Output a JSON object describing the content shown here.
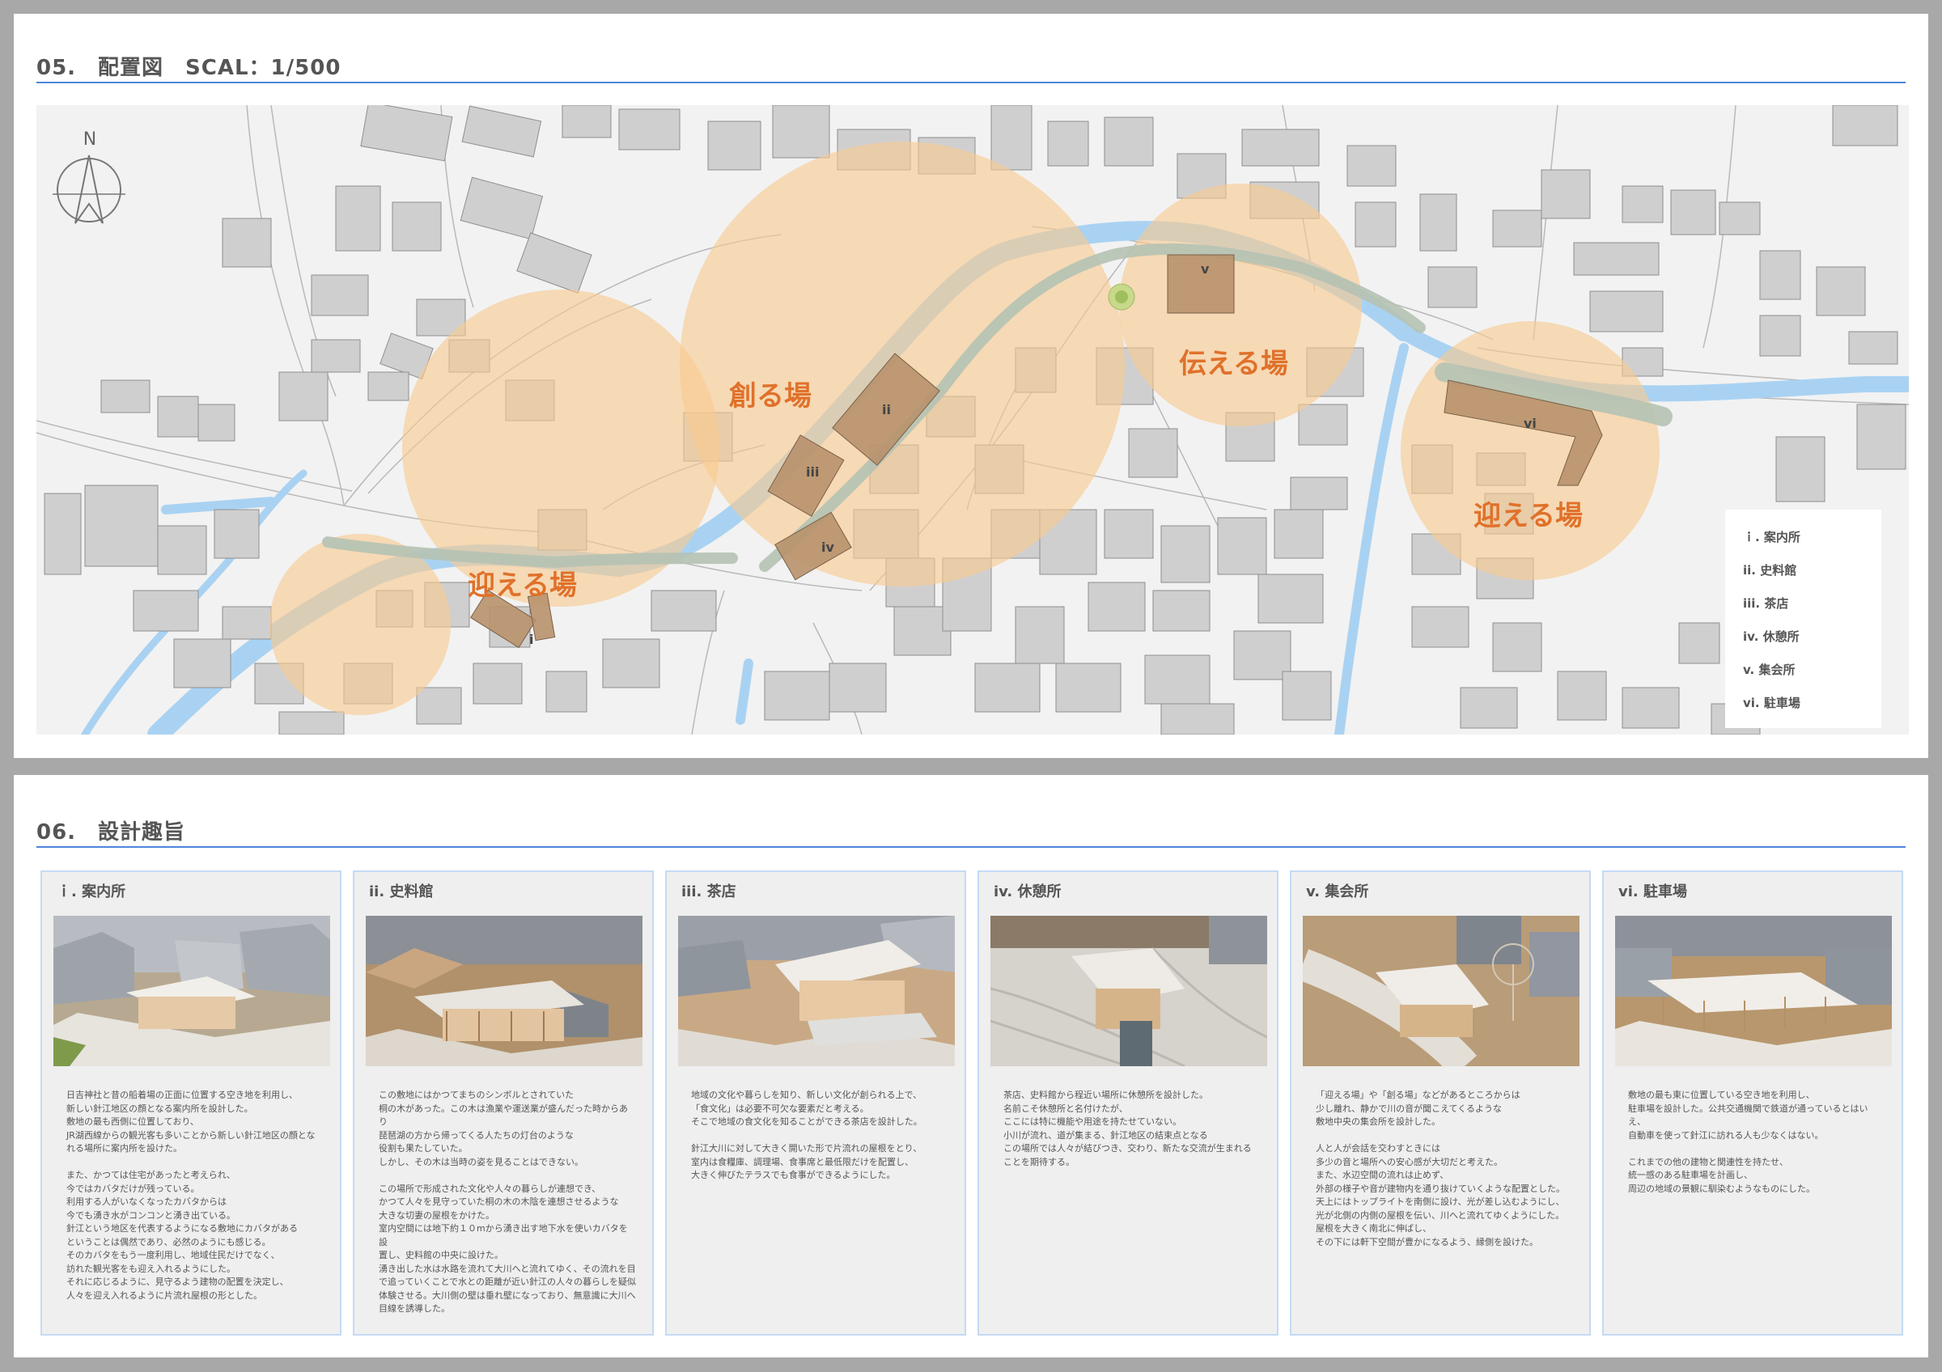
{
  "site_plan": {
    "title": "05.　配置図　SCAL：1/500",
    "north_label": "N",
    "zones": [
      "創る場",
      "伝える場",
      "迎える場",
      "迎える場"
    ],
    "buildings": [
      "i",
      "ii",
      "iii",
      "iv",
      "v",
      "vi"
    ],
    "legend": [
      "ｉ. 案内所",
      "ii. 史料館",
      "iii. 茶店",
      "iv. 休憩所",
      "v. 集会所",
      "vi. 駐車場"
    ]
  },
  "design": {
    "title": "06.　設計趣旨",
    "cards": [
      {
        "title": "ｉ. 案内所",
        "text": "日吉神社と昔の船着場の正面に位置する空き地を利用し、\n新しい針江地区の顔となる案内所を設計した。\n敷地の最も西側に位置しており、\nJR湖西線からの観光客も多いことから新しい針江地区の顔とな\nれる場所に案内所を設けた。\n\nまた、かつては住宅があったと考えられ、\n今ではカバタだけが残っている。\n利用する人がいなくなったカバタからは\n今でも湧き水がコンコンと湧き出ている。\n針江という地区を代表するようになる敷地にカバタがある\nということは偶然であり、必然のようにも感じる。\nそのカバタをもう一度利用し、地域住民だけでなく、\n訪れた観光客をも迎え入れるようにした。\nそれに応じるように、見守るよう建物の配置を決定し、\n人々を迎え入れるように片流れ屋根の形とした。"
      },
      {
        "title": "ii. 史料館",
        "text": "この敷地にはかつてまちのシンボルとされていた\n桐の木があった。この木は漁業や運送業が盛んだった時からあり\n琵琶湖の方から帰ってくる人たちの灯台のような\n役割も果たしていた。\nしかし、その木は当時の姿を見ることはできない。\n\nこの場所で形成された文化や人々の暮らしが連想でき、\nかつて人々を見守っていた桐の木の木陰を連想させるような\n大きな切妻の屋根をかけた。\n室内空間には地下約１０mから湧き出す地下水を使いカバタを設\n置し、史料館の中央に設けた。\n湧き出した水は水路を流れて大川へと流れてゆく、その流れを目\nで追っていくことで水との距離が近い針江の人々の暮らしを疑似\n体験させる。大川側の壁は垂れ壁になっており、無意識に大川へ\n目線を誘導した。"
      },
      {
        "title": "iii. 茶店",
        "text": "地域の文化や暮らしを知り、新しい文化が創られる上で、\n「食文化」は必要不可欠な要素だと考える。\nそこで地域の食文化を知ることができる茶店を設計した。\n\n針江大川に対して大きく開いた形で片流れの屋根をとり、\n室内は食糧庫、調理場、食事席と最低限だけを配置し、\n大きく伸びたテラスでも食事ができるようにした。"
      },
      {
        "title": "iv. 休憩所",
        "text": "茶店、史料館から程近い場所に休憩所を設計した。\n名前こそ休憩所と名付けたが、\nここには特に機能や用途を持たせていない。\n小川が流れ、道が集まる、針江地区の結束点となる\nこの場所では人々が結びつき、交わり、新たな交流が生まれる\nことを期待する。"
      },
      {
        "title": "v. 集会所",
        "text": "「迎える場」や「創る場」などがあるところからは\n少し離れ、静かで川の音が聞こえてくるような\n敷地中央の集会所を設計した。\n\n人と人が会話を交わすときには\n多少の音と場所への安心感が大切だと考えた。\nまた、水辺空間の流れは止めず、\n外部の様子や音が建物内を通り抜けていくような配置とした。\n天上にはトップライトを南側に設け、光が差し込むようにし、\n光が北側の内側の屋根を伝い、川へと流れてゆくようにした。\n屋根を大きく南北に伸ばし、\nその下には軒下空間が豊かになるよう、縁側を設けた。"
      },
      {
        "title": "vi. 駐車場",
        "text": "敷地の最も東に位置している空き地を利用し、\n駐車場を設計した。公共交通機関で鉄道が通っているとはいえ、\n自動車を使って針江に訪れる人も少なくはない。\n\nこれまでの他の建物と関連性を持たせ、\n統一感のある駐車場を計画し、\n周辺の地域の景観に馴染むようなものにした。"
      }
    ]
  },
  "colors": {
    "accent_rule": "#4f86d9",
    "zone_fill": "#f9c98f",
    "zone_text": "#e0712a",
    "water": "#a9d2f2",
    "building_fill": "#d0cfcf",
    "project_building": "#b8916b",
    "path_band": "#b5c2b2"
  }
}
